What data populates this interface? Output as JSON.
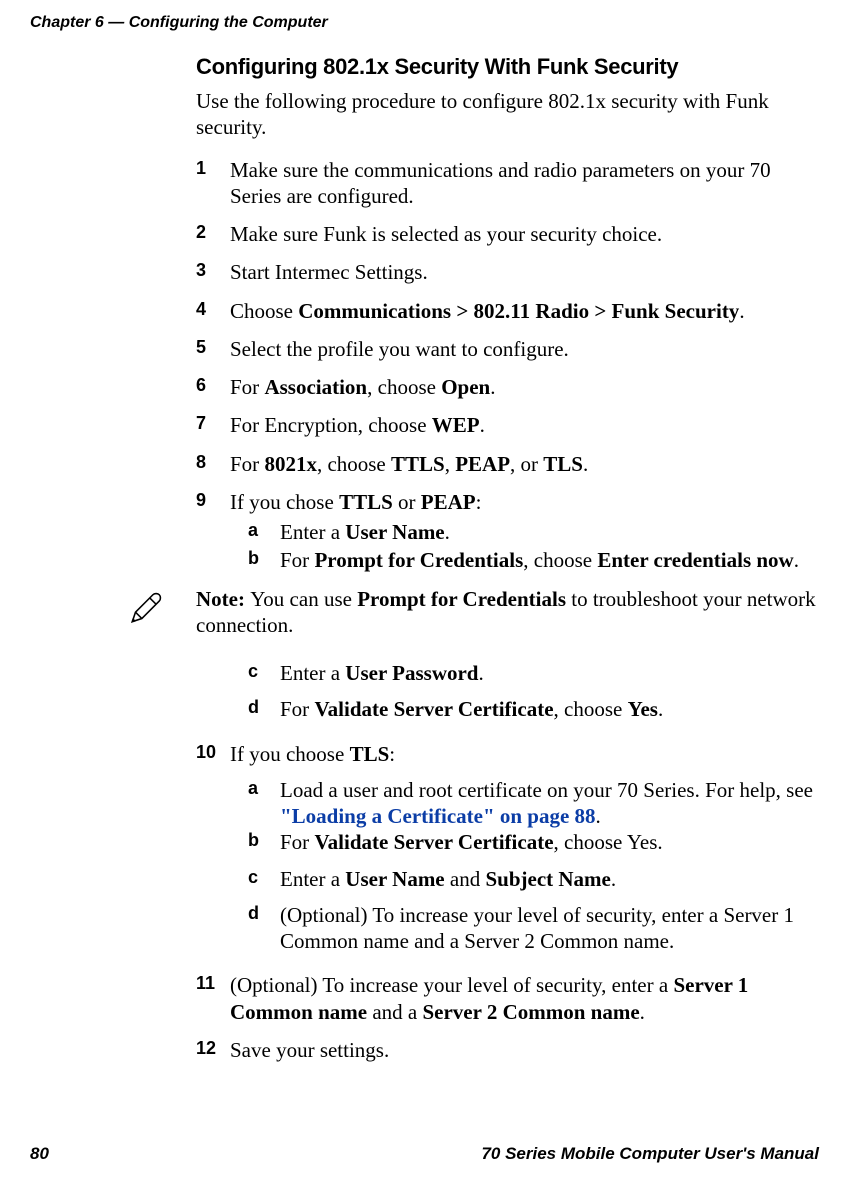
{
  "header": {
    "chapter": "Chapter 6 — Configuring the Computer"
  },
  "footer": {
    "page_number": "80",
    "manual_title": "70 Series Mobile Computer User's Manual"
  },
  "section": {
    "title": "Configuring 802.1x Security With Funk Security",
    "intro": "Use the following procedure to configure 802.1x security with Funk security."
  },
  "steps": {
    "s1": "Make sure the communications and radio parameters on your 70 Series are configured.",
    "s2": "Make sure Funk is selected as your security choice.",
    "s3": "Start Intermec Settings.",
    "s4_pre": "Choose ",
    "s4_bold": "Communications > 802.11 Radio >  Funk Security",
    "s5": "Select the profile you want to configure.",
    "s6_pre": "For ",
    "s6_b1": "Association",
    "s6_mid": ", choose ",
    "s6_b2": "Open",
    "s7_pre": "For Encryption, choose ",
    "s7_b": "WEP",
    "s8_pre": "For ",
    "s8_b1": "8021x",
    "s8_mid1": ", choose ",
    "s8_b2": "TTLS",
    "s8_c1": ", ",
    "s8_b3": "PEAP",
    "s8_c2": ", or ",
    "s8_b4": "TLS",
    "s9_pre": "If you chose ",
    "s9_b1": "TTLS",
    "s9_mid": " or ",
    "s9_b2": "PEAP",
    "s9a_pre": "Enter a ",
    "s9a_b": "User Name",
    "s9b_pre": "For ",
    "s9b_b1": "Prompt for Credentials",
    "s9b_mid": ", choose ",
    "s9b_b2": "Enter credentials now",
    "s9c_pre": "Enter a ",
    "s9c_b": "User Password",
    "s9d_pre": "For ",
    "s9d_b1": "Validate Server Certificate",
    "s9d_mid": ", choose ",
    "s9d_b2": "Yes",
    "s10_pre": "If you choose ",
    "s10_b": "TLS",
    "s10a_pre": "Load a user and root certificate on your 70 Series. For help, see ",
    "s10a_link": "\"Loading a Certificate\" on page 88",
    "s10b_pre": "For ",
    "s10b_b1": "Validate Server Certificate",
    "s10b_mid": ", choose Yes.",
    "s10c_pre": "Enter a ",
    "s10c_b1": "User Name",
    "s10c_mid": " and ",
    "s10c_b2": "Subject Name",
    "s10d": "(Optional) To increase your level of security, enter a Server 1 Common name and a Server 2 Common name.",
    "s11_pre": "(Optional) To increase your level of security, enter a ",
    "s11_b1": "Server 1 Common name",
    "s11_mid": " and a ",
    "s11_b2": "Server 2 Common name",
    "s12": "Save your settings."
  },
  "note": {
    "label": "Note:  ",
    "text_pre": "You can use ",
    "text_b": "Prompt for Credentials",
    "text_post": " to troubleshoot your network connection."
  }
}
